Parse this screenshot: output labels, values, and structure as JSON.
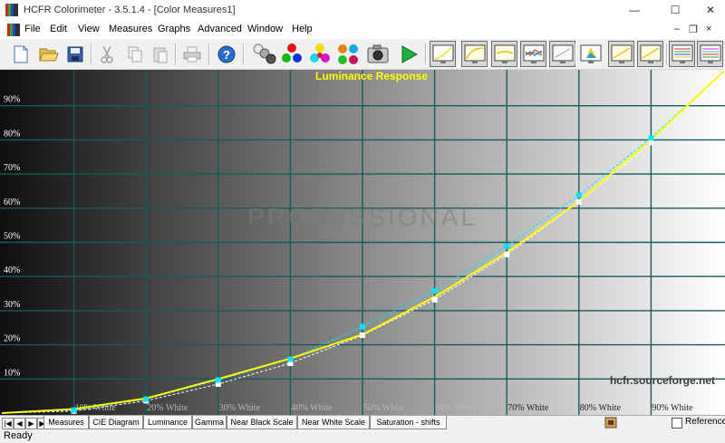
{
  "window": {
    "title": "HCFR Colorimeter - 3.5.1.4 - [Color Measures1]",
    "controls": {
      "minimize": "—",
      "maximize": "☐",
      "close": "✕"
    }
  },
  "menu": {
    "items": [
      "File",
      "Edit",
      "View",
      "Measures",
      "Graphs",
      "Advanced",
      "Window",
      "Help"
    ],
    "mdi_controls": {
      "minimize": "–",
      "restore": "❐",
      "close": "×"
    }
  },
  "toolbar": {
    "buttons": [
      "new-document-icon",
      "open-folder-icon",
      "save-disk-icon",
      "cut-scissors-icon",
      "copy-icon",
      "paste-icon",
      "print-icon",
      "help-icon",
      "grayscale-balls-icon",
      "rgb-balls-icon",
      "cmy-balls-icon",
      "multicolor-cube-icon",
      "camera-icon",
      "play-arrow-icon"
    ],
    "view_toggles": [
      "luminance-view-icon",
      "gamma-view-icon",
      "rgb-levels-view-icon",
      "color-temp-view-icon",
      "cie-view-icon",
      "colorspace-view-icon",
      "near-black-view-icon",
      "near-white-view-icon",
      "saturation-view-icon",
      "saturation-shift-view-icon"
    ]
  },
  "chart_data": {
    "type": "line",
    "title": "Luminance Response",
    "watermark": "PROFESSIONAL",
    "source_label": "hcfr.sourceforge.net",
    "x": [
      0,
      10,
      20,
      30,
      40,
      50,
      60,
      70,
      80,
      90,
      100
    ],
    "x_tick_labels": [
      "10% White",
      "20% White",
      "30% White",
      "40% White",
      "50% White",
      "60% White",
      "70% White",
      "80% White",
      "90% White"
    ],
    "y_tick_labels": [
      "10%",
      "20%",
      "30%",
      "40%",
      "50%",
      "60%",
      "70%",
      "80%",
      "90%"
    ],
    "ylim": [
      0,
      100
    ],
    "xlim": [
      0,
      100
    ],
    "series": [
      {
        "color": "#ffff00",
        "values": [
          0,
          1.2,
          4.3,
          10,
          16,
          23,
          34,
          47,
          62,
          80,
          100
        ]
      },
      {
        "color": "#00e5ff",
        "values": [
          0,
          0.9,
          4.1,
          9.7,
          15.8,
          25.3,
          35.8,
          48.9,
          63.8,
          80.6,
          100
        ]
      },
      {
        "color": "#ffffff",
        "values": [
          0,
          0.6,
          3.6,
          8.5,
          14.6,
          22.8,
          33.2,
          46.4,
          61.8,
          79.2,
          100
        ]
      }
    ],
    "grid": true
  },
  "tabs": {
    "nav": [
      "|◀",
      "◀",
      "▶",
      "▶|"
    ],
    "items": [
      "Measures",
      "CIE Diagram",
      "Luminance",
      "Gamma",
      "Near Black Scale",
      "Near White Scale",
      "Saturation - shifts"
    ],
    "active": "Luminance"
  },
  "reference_label": "Reference",
  "status": "Ready"
}
